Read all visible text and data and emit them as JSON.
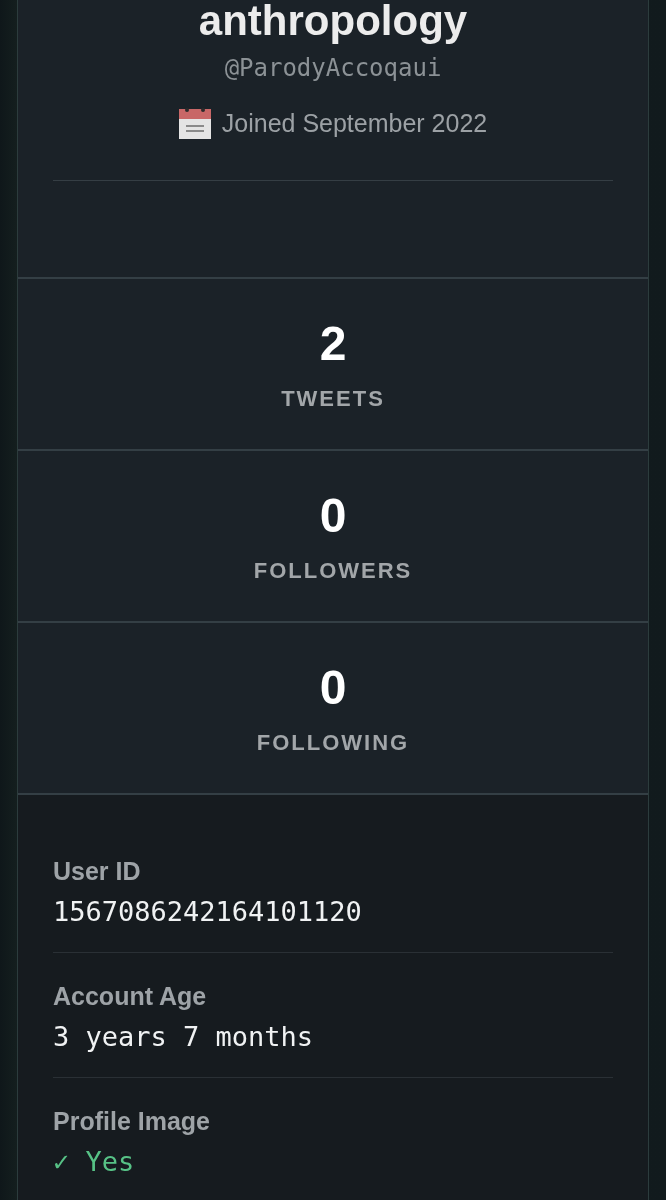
{
  "profile": {
    "name": "anthropology",
    "handle": "@ParodyAccoqaui",
    "joined": "Joined September 2022"
  },
  "stats": [
    {
      "value": "2",
      "label": "TWEETS"
    },
    {
      "value": "0",
      "label": "FOLLOWERS"
    },
    {
      "value": "0",
      "label": "FOLLOWING"
    }
  ],
  "details": [
    {
      "label": "User ID",
      "value": "1567086242164101120",
      "kind": "text"
    },
    {
      "label": "Account Age",
      "value": "3 years 7 months",
      "kind": "text"
    },
    {
      "label": "Profile Image",
      "value": "✓ Yes",
      "kind": "status"
    }
  ]
}
